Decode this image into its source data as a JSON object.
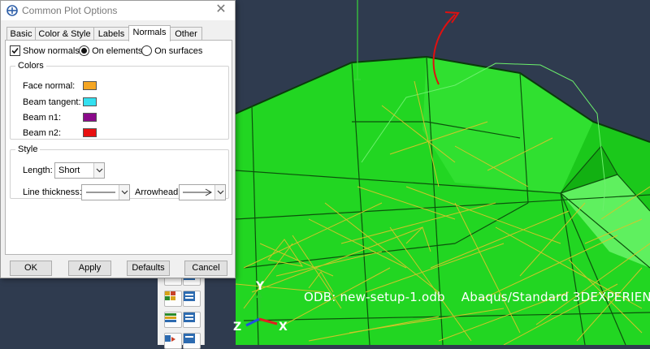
{
  "dialog": {
    "title": "Common Plot Options",
    "tabs": [
      {
        "label": "Basic",
        "active": false
      },
      {
        "label": "Color & Style",
        "active": false
      },
      {
        "label": "Labels",
        "active": false
      },
      {
        "label": "Normals",
        "active": true
      },
      {
        "label": "Other",
        "active": false
      }
    ],
    "show_normals": {
      "label": "Show normals",
      "checked": true
    },
    "placement": {
      "options": [
        {
          "label": "On elements",
          "selected": true
        },
        {
          "label": "On surfaces",
          "selected": false
        }
      ]
    },
    "colors_group": {
      "title": "Colors",
      "rows": [
        {
          "label": "Face normal:",
          "color": "#f5a623"
        },
        {
          "label": "Beam tangent:",
          "color": "#33e0f0"
        },
        {
          "label": "Beam n1:",
          "color": "#8a0a8a"
        },
        {
          "label": "Beam n2:",
          "color": "#e81010"
        }
      ]
    },
    "style_group": {
      "title": "Style",
      "length_label": "Length:",
      "length_value": "Short",
      "line_thickness_label": "Line thickness:",
      "arrowhead_label": "Arrowhead:"
    },
    "buttons": {
      "ok": "OK",
      "apply": "Apply",
      "defaults": "Defaults",
      "cancel": "Cancel"
    }
  },
  "viewport": {
    "odb_name": "ODB: new-setup-1.odb",
    "solver_text": "Abaqus/Standard 3DEXPERIEN",
    "triad": {
      "y": "Y",
      "x": "X",
      "z": "Z"
    },
    "background_color": "#2f3b4f",
    "mesh_color": "#1fd81f",
    "normals_color": "#e0c020"
  }
}
